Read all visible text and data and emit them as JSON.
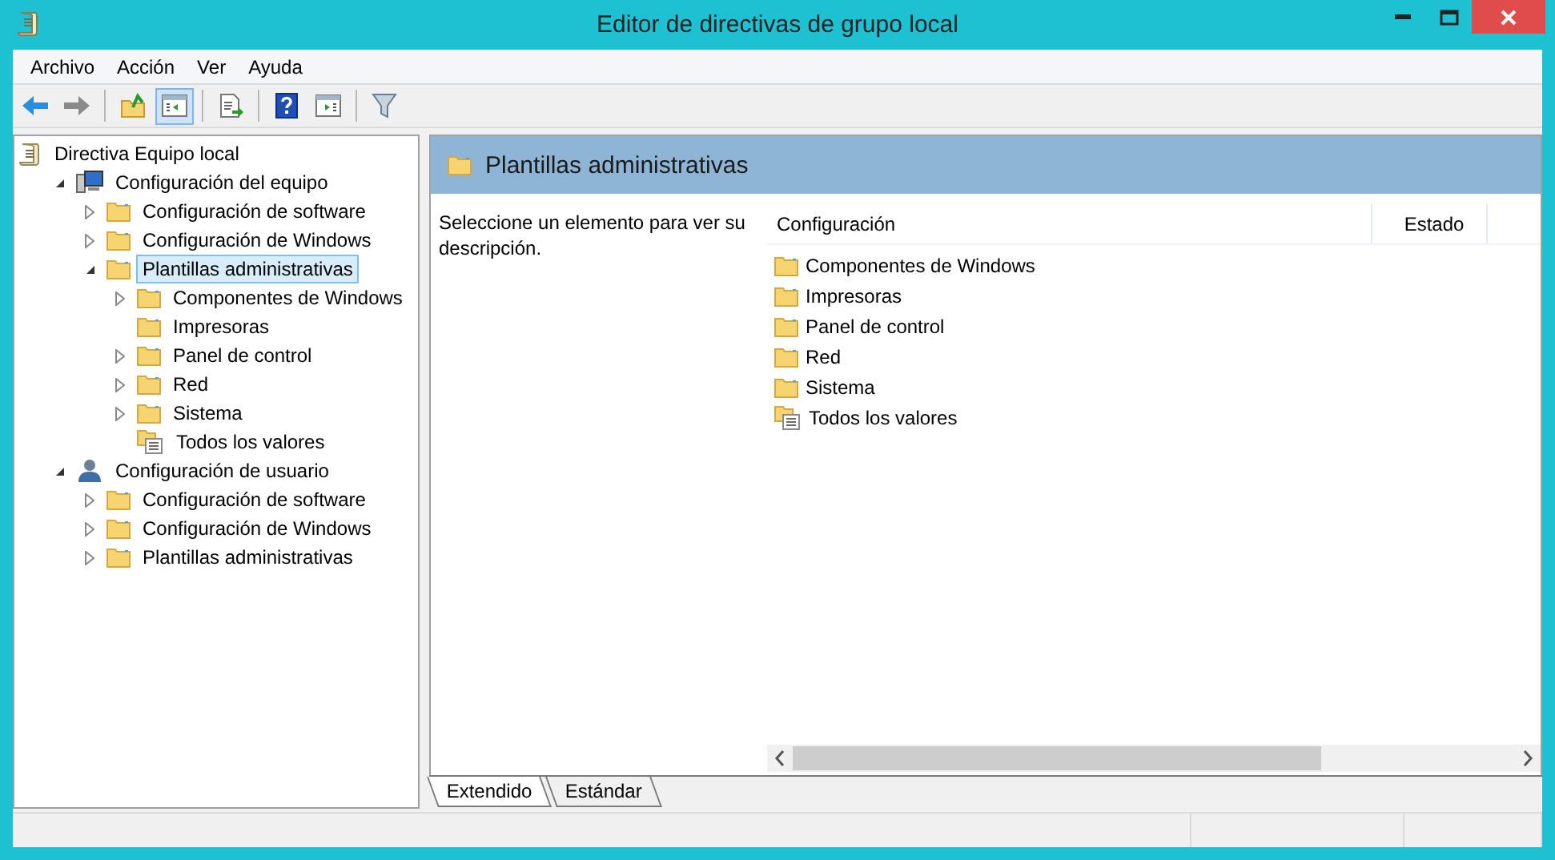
{
  "window": {
    "title": "Editor de directivas de grupo local"
  },
  "menu": [
    "Archivo",
    "Acción",
    "Ver",
    "Ayuda"
  ],
  "toolbar": [
    {
      "kind": "back",
      "pressed": false
    },
    {
      "kind": "forward",
      "pressed": false
    },
    {
      "kind": "sep"
    },
    {
      "kind": "up",
      "pressed": false
    },
    {
      "kind": "tree",
      "pressed": true
    },
    {
      "kind": "sep"
    },
    {
      "kind": "export",
      "pressed": false
    },
    {
      "kind": "sep"
    },
    {
      "kind": "help",
      "pressed": false
    },
    {
      "kind": "pane",
      "pressed": false
    },
    {
      "kind": "sep"
    },
    {
      "kind": "filter",
      "pressed": false
    }
  ],
  "tree": [
    {
      "label": "Directiva Equipo local",
      "kind": "scroll",
      "selected": false,
      "children": [
        {
          "label": "Configuración del equipo",
          "kind": "computer",
          "selected": false,
          "expanded": true,
          "children": [
            {
              "label": "Configuración de software",
              "kind": "folder",
              "selected": false,
              "expanded": false
            },
            {
              "label": "Configuración de Windows",
              "kind": "folder",
              "selected": false,
              "expanded": false
            },
            {
              "label": "Plantillas administrativas",
              "kind": "folder",
              "selected": true,
              "expanded": true,
              "children": [
                {
                  "label": "Componentes de Windows",
                  "kind": "folder",
                  "selected": false,
                  "expanded": false
                },
                {
                  "label": "Impresoras",
                  "kind": "folder",
                  "selected": false
                },
                {
                  "label": "Panel de control",
                  "kind": "folder",
                  "selected": false,
                  "expanded": false
                },
                {
                  "label": "Red",
                  "kind": "folder",
                  "selected": false,
                  "expanded": false
                },
                {
                  "label": "Sistema",
                  "kind": "folder",
                  "selected": false,
                  "expanded": false
                },
                {
                  "label": "Todos los valores",
                  "kind": "settings",
                  "selected": false
                }
              ]
            }
          ]
        },
        {
          "label": "Configuración de usuario",
          "kind": "user",
          "selected": false,
          "expanded": true,
          "children": [
            {
              "label": "Configuración de software",
              "kind": "folder",
              "selected": false,
              "expanded": false
            },
            {
              "label": "Configuración de Windows",
              "kind": "folder",
              "selected": false,
              "expanded": false
            },
            {
              "label": "Plantillas administrativas",
              "kind": "folder",
              "selected": false,
              "expanded": false
            }
          ]
        }
      ]
    }
  ],
  "detail": {
    "title": "Plantillas administrativas",
    "description": "Seleccione un elemento para ver su descripción.",
    "columns": [
      "Configuración",
      "Estado"
    ],
    "rows": [
      {
        "name": "Componentes de Windows",
        "kind": "folder"
      },
      {
        "name": "Impresoras",
        "kind": "folder"
      },
      {
        "name": "Panel de control",
        "kind": "folder"
      },
      {
        "name": "Red",
        "kind": "folder"
      },
      {
        "name": "Sistema",
        "kind": "folder"
      },
      {
        "name": "Todos los valores",
        "kind": "settings"
      }
    ]
  },
  "tabs": [
    {
      "label": "Extendido",
      "selected": true
    },
    {
      "label": "Estándar",
      "selected": false
    }
  ]
}
